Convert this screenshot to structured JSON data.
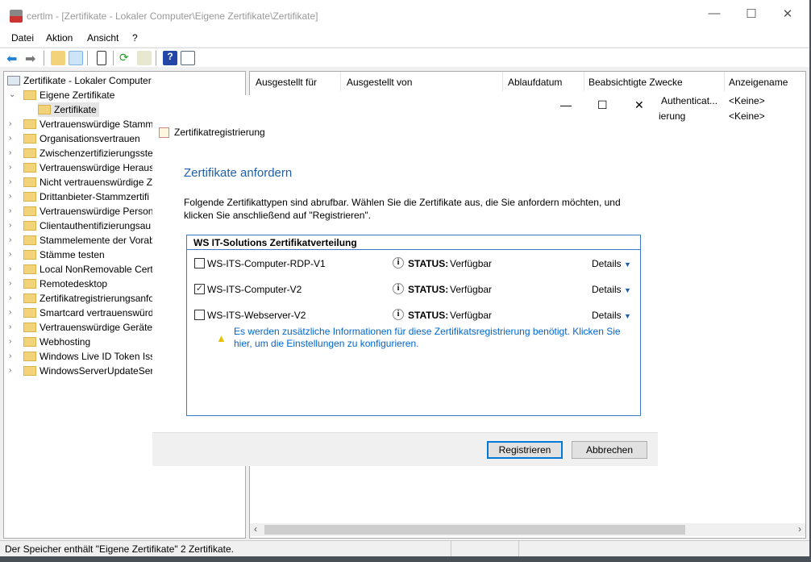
{
  "window": {
    "title": "certlm - [Zertifikate - Lokaler Computer\\Eigene Zertifikate\\Zertifikate]",
    "minimize": "—",
    "maximize": "☐",
    "close": "✕"
  },
  "menu": [
    "Datei",
    "Aktion",
    "Ansicht",
    "?"
  ],
  "tree": {
    "root": "Zertifikate - Lokaler Computer",
    "expanded": "Eigene Zertifikate",
    "selected": "Zertifikate",
    "items": [
      "Vertrauenswürdige Stamm",
      "Organisationsvertrauen",
      "Zwischenzertifizierungsste",
      "Vertrauenswürdige Heraus",
      "Nicht vertrauenswürdige Z",
      "Drittanbieter-Stammzertifi",
      "Vertrauenswürdige Persone",
      "Clientauthentifizierungsau",
      "Stammelemente der Vorab",
      "Stämme testen",
      "Local NonRemovable Cert",
      "Remotedesktop",
      "Zertifikatregistrierungsanfo",
      "Smartcard vertrauenswürd",
      "Vertrauenswürdige Geräte",
      "Webhosting",
      "Windows Live ID Token Iss",
      "WindowsServerUpdateServ"
    ]
  },
  "list": {
    "columns": [
      "Ausgestellt für",
      "Ausgestellt von",
      "Ablaufdatum",
      "Beabsichtigte Zwecke",
      "Anzeigename"
    ],
    "rows": [
      {
        "purpose": "Authenticat...",
        "name": "<Keine>"
      },
      {
        "purpose": "ierung",
        "name": "<Keine>"
      }
    ]
  },
  "status": "Der Speicher enthält \"Eigene Zertifikate\" 2 Zertifikate.",
  "dialog": {
    "title": "Zertifikatregistrierung",
    "heading": "Zertifikate anfordern",
    "description": "Folgende Zertifikattypen sind abrufbar. Wählen Sie die Zertifikate aus, die Sie anfordern möchten, und klicken Sie anschließend auf \"Registrieren\".",
    "group": "WS IT-Solutions Zertifikatverteilung",
    "status_label": "STATUS:",
    "details_label": "Details",
    "templates": [
      {
        "name": "WS-ITS-Computer-RDP-V1",
        "checked": false,
        "status": "Verfügbar"
      },
      {
        "name": "WS-ITS-Computer-V2",
        "checked": true,
        "status": "Verfügbar"
      },
      {
        "name": "WS-ITS-Webserver-V2",
        "checked": false,
        "status": "Verfügbar"
      }
    ],
    "warning": "Es werden zusätzliche Informationen für diese Zertifikatsregistrierung benötigt. Klicken Sie hier, um die Einstellungen zu konfigurieren.",
    "register": "Registrieren",
    "cancel": "Abbrechen",
    "minimize": "—",
    "maximize": "☐",
    "close": "✕"
  },
  "colors": {
    "accent": "#0078d7",
    "heading": "#1e5fa8",
    "link": "#0066cc"
  }
}
